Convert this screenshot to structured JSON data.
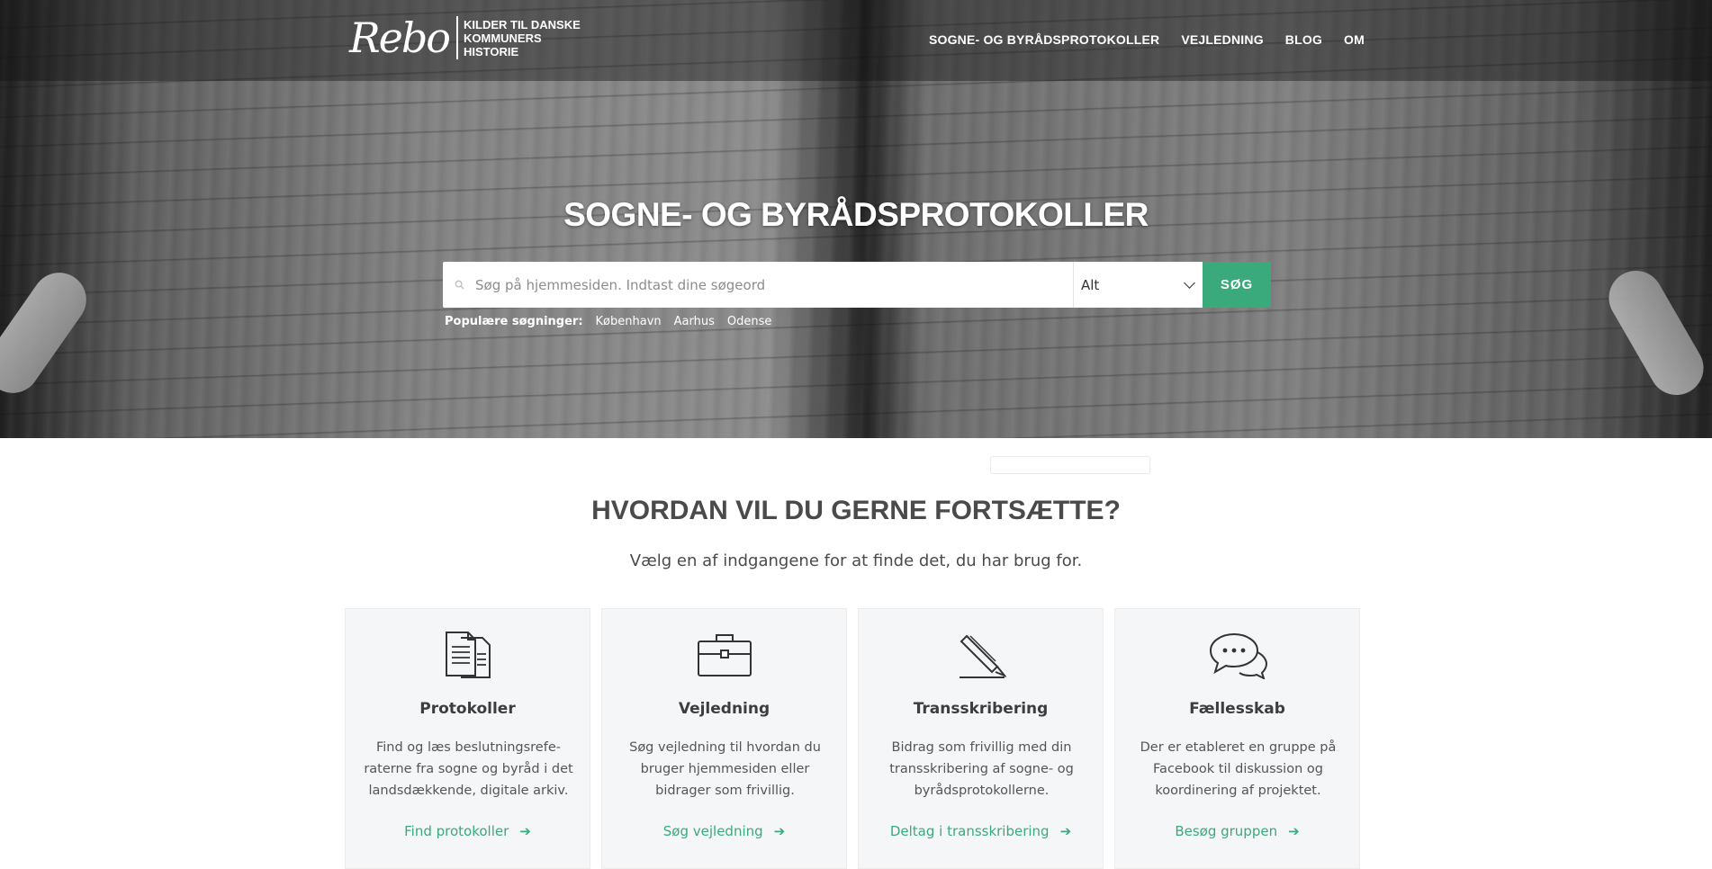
{
  "header": {
    "logo_script": "Rebo",
    "logo_lines": [
      "KILDER TIL DANSKE",
      "KOMMUNERS",
      "HISTORIE"
    ],
    "nav": [
      "SOGNE- OG BYRÅDSPROTOKOLLER",
      "VEJLEDNING",
      "BLOG",
      "OM"
    ]
  },
  "hero": {
    "title": "SOGNE- OG BYRÅDSPROTOKOLLER",
    "search_placeholder": "Søg på hjemmesiden. Indtast dine søgeord",
    "select_value": "Alt",
    "search_button": "SØG",
    "popular_label": "Populære søgninger:",
    "popular": [
      "København",
      "Aarhus",
      "Odense"
    ]
  },
  "main": {
    "title": "HVORDAN VIL DU GERNE FORTSÆTTE?",
    "subtitle": "Vælg en af indgangene for at finde det, du har brug for.",
    "cards": [
      {
        "icon": "document-icon",
        "title": "Protokoller",
        "text": "Find og læs beslutningsrefe-raterne fra sogne og byråd i det landsdækkende, digitale arkiv.",
        "link": "Find protokoller"
      },
      {
        "icon": "briefcase-icon",
        "title": "Vejledning",
        "text": "Søg vejledning til hvordan du bruger hjemmesiden eller bidrager som frivillig.",
        "link": "Søg vejledning"
      },
      {
        "icon": "pencil-icon",
        "title": "Transskribering",
        "text": "Bidrag som frivillig med din transskribering af sogne- og byrådsprotokollerne.",
        "link": "Deltag i transskribering"
      },
      {
        "icon": "chat-icon",
        "title": "Fællesskab",
        "text": "Der er etableret en gruppe på Facebook til diskussion og koordinering af projektet.",
        "link": "Besøg gruppen"
      }
    ]
  },
  "colors": {
    "accent": "#3aaa7c",
    "text": "#4a4a4a"
  }
}
